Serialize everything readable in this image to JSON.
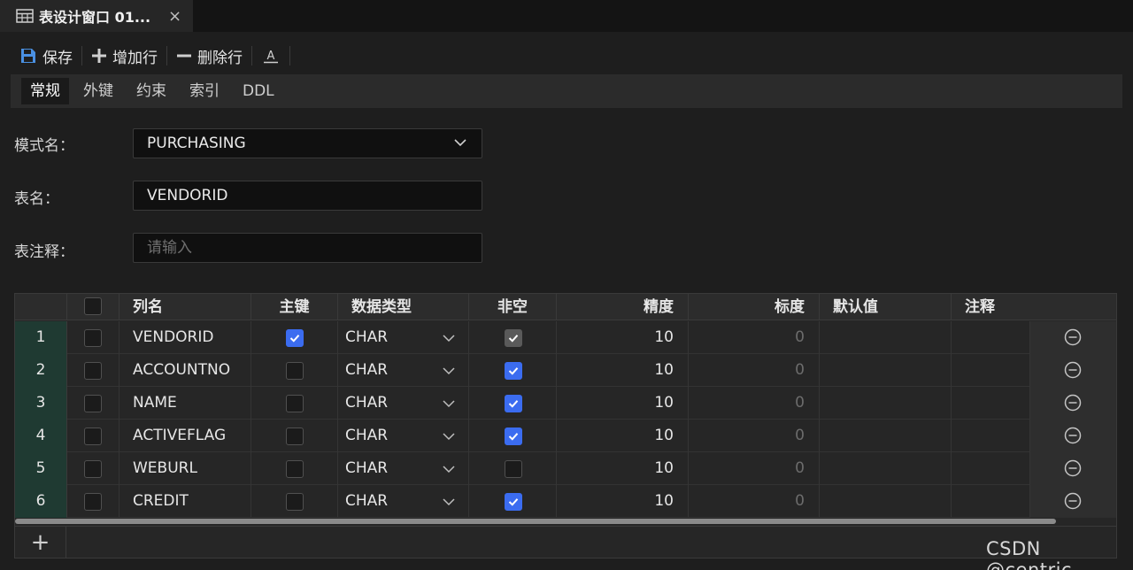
{
  "tab": {
    "title": "表设计窗口 01...",
    "close": "×"
  },
  "toolbar": {
    "save": "保存",
    "add_row": "增加行",
    "delete_row": "删除行",
    "text_icon": "A"
  },
  "subtabs": [
    "常规",
    "外键",
    "约束",
    "索引",
    "DDL"
  ],
  "form": {
    "schema_label": "模式名：",
    "schema_value": "PURCHASING",
    "table_label": "表名：",
    "table_value": "VENDORID",
    "comment_label": "表注释：",
    "comment_placeholder": "请输入"
  },
  "grid": {
    "headers": {
      "name": "列名",
      "pk": "主键",
      "type": "数据类型",
      "notnull": "非空",
      "precision": "精度",
      "scale": "标度",
      "default": "默认值",
      "comment": "注释"
    },
    "rows": [
      {
        "num": "1",
        "name": "VENDORID",
        "pk": true,
        "type": "CHAR",
        "notnull": "checked-disabled",
        "precision": "10",
        "scale": "0"
      },
      {
        "num": "2",
        "name": "ACCOUNTNO",
        "pk": false,
        "type": "CHAR",
        "notnull": "checked",
        "precision": "10",
        "scale": "0"
      },
      {
        "num": "3",
        "name": "NAME",
        "pk": false,
        "type": "CHAR",
        "notnull": "checked",
        "precision": "10",
        "scale": "0"
      },
      {
        "num": "4",
        "name": "ACTIVEFLAG",
        "pk": false,
        "type": "CHAR",
        "notnull": "checked",
        "precision": "10",
        "scale": "0"
      },
      {
        "num": "5",
        "name": "WEBURL",
        "pk": false,
        "type": "CHAR",
        "notnull": "unchecked",
        "precision": "10",
        "scale": "0"
      },
      {
        "num": "6",
        "name": "CREDIT",
        "pk": false,
        "type": "CHAR",
        "notnull": "checked",
        "precision": "10",
        "scale": "0"
      }
    ],
    "add_label": "+"
  },
  "watermark": "CSDN @centric",
  "colors": {
    "accent": "#3b6cf0",
    "rownum_bg": "#1f3a32",
    "save_icon": "#4a90e2"
  }
}
